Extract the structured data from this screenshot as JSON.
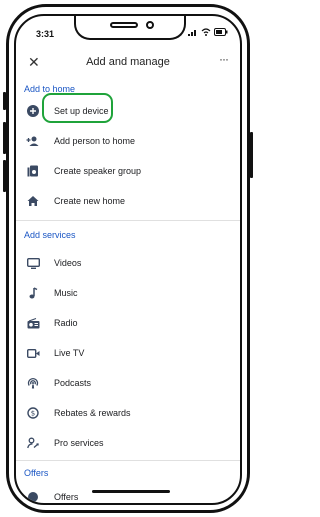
{
  "status": {
    "time": "3:31"
  },
  "header": {
    "title": "Add and manage",
    "close_icon": "close-icon",
    "more_icon": "more-icon"
  },
  "sections": {
    "add_to_home": {
      "title": "Add to home",
      "items": [
        {
          "label": "Set up device",
          "icon": "plus-circle-icon"
        },
        {
          "label": "Add person to home",
          "icon": "add-person-icon"
        },
        {
          "label": "Create speaker group",
          "icon": "speaker-group-icon"
        },
        {
          "label": "Create new home",
          "icon": "home-icon"
        }
      ]
    },
    "add_services": {
      "title": "Add services",
      "items": [
        {
          "label": "Videos",
          "icon": "tv-icon"
        },
        {
          "label": "Music",
          "icon": "music-note-icon"
        },
        {
          "label": "Radio",
          "icon": "radio-icon"
        },
        {
          "label": "Live TV",
          "icon": "live-tv-icon"
        },
        {
          "label": "Podcasts",
          "icon": "podcasts-icon"
        },
        {
          "label": "Rebates & rewards",
          "icon": "rebates-icon"
        },
        {
          "label": "Pro services",
          "icon": "pro-services-icon"
        }
      ]
    },
    "offers": {
      "title": "Offers",
      "items": [
        {
          "label": "Offers",
          "icon": "offers-icon"
        }
      ]
    }
  },
  "colors": {
    "accent": "#1a56c4",
    "highlight": "#1fa33a"
  }
}
